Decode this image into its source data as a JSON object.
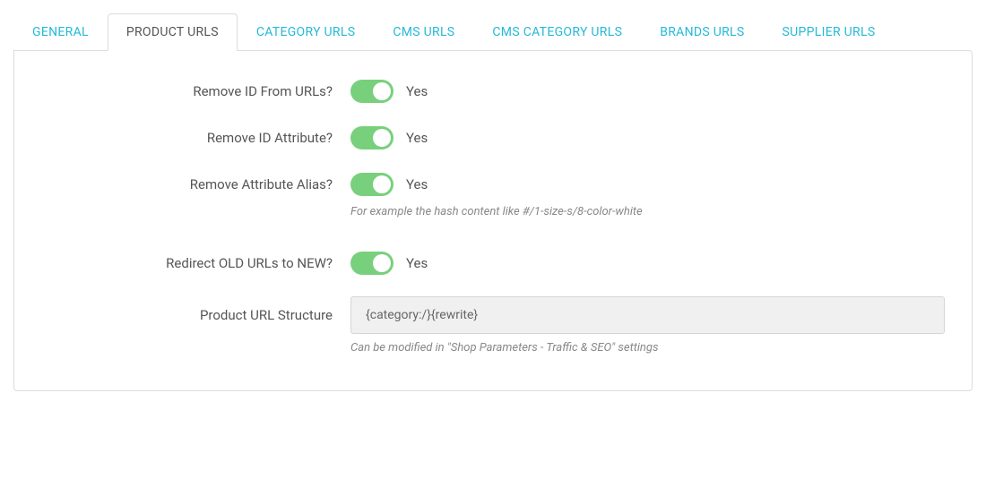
{
  "tabs": {
    "general": "General",
    "product_urls": "Product URLs",
    "category_urls": "Category URLs",
    "cms_urls": "CMS URLs",
    "cms_category_urls": "CMS Category URLs",
    "brands_urls": "Brands URLs",
    "supplier_urls": "Supplier URLs"
  },
  "form": {
    "remove_id": {
      "label": "Remove ID From URLs?",
      "state": "Yes"
    },
    "remove_id_attr": {
      "label": "Remove ID Attribute?",
      "state": "Yes"
    },
    "remove_attr_alias": {
      "label": "Remove Attribute Alias?",
      "state": "Yes",
      "helper": "For example the hash content like #/1-size-s/8-color-white"
    },
    "redirect_old": {
      "label": "Redirect OLD URLs to NEW?",
      "state": "Yes"
    },
    "url_structure": {
      "label": "Product URL Structure",
      "value": "{category:/}{rewrite}",
      "helper": "Can be modified in \"Shop Parameters - Traffic & SEO\" settings"
    }
  }
}
